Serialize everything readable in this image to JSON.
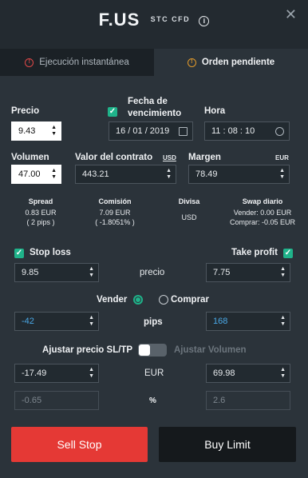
{
  "header": {
    "symbol": "F.US",
    "subtitle": "STC CFD",
    "info_icon": "info-icon",
    "close_icon": "close-icon"
  },
  "tabs": [
    {
      "label": "Ejecución instantánea",
      "active": false,
      "icon_color": "#e04848"
    },
    {
      "label": "Orden pendiente",
      "active": true,
      "icon_color": "#e39a2a"
    }
  ],
  "order": {
    "precio_label": "Precio",
    "precio_value": "9.43",
    "fecha_label_1": "Fecha de",
    "fecha_label_2": "vencimiento",
    "fecha_value": "16 / 01 / 2019",
    "hora_label": "Hora",
    "hora_value": "11 : 08 : 10",
    "volumen_label": "Volumen",
    "volumen_value": "47.00",
    "valor_label": "Valor del contrato",
    "valor_currency": "USD",
    "valor_value": "443.21",
    "margen_label": "Margen",
    "margen_currency": "EUR",
    "margen_value": "78.49"
  },
  "info": {
    "spread_label": "Spread",
    "spread_value": "0.83 EUR",
    "spread_pips": "( 2 pips )",
    "comision_label": "Comisión",
    "comision_value": "7.09 EUR",
    "comision_pct": "( -1.8051% )",
    "divisa_label": "Divisa",
    "divisa_value": "USD",
    "swap_label": "Swap diario",
    "swap_vender": "Vender: 0.00 EUR",
    "swap_comprar": "Comprar: -0.05 EUR"
  },
  "sltp": {
    "stop_loss_label": "Stop loss",
    "take_profit_label": "Take profit",
    "sl_price": "9.85",
    "tp_price": "7.75",
    "precio_mid": "precio",
    "vender_label": "Vender",
    "comprar_label": "Comprar",
    "sl_pips": "-42",
    "tp_pips": "168",
    "pips_mid": "pips",
    "ajustar_sltp_label": "Ajustar precio SL/TP",
    "ajustar_volumen_label": "Ajustar Volumen",
    "sl_eur": "-17.49",
    "tp_eur": "69.98",
    "eur_mid": "EUR",
    "sl_pct": "-0.65",
    "tp_pct": "2.6",
    "pct_mid": "%"
  },
  "buttons": {
    "sell_label": "Sell Stop",
    "buy_label": "Buy Limit",
    "sell_color": "#e53935",
    "buy_color": "#15191c"
  }
}
